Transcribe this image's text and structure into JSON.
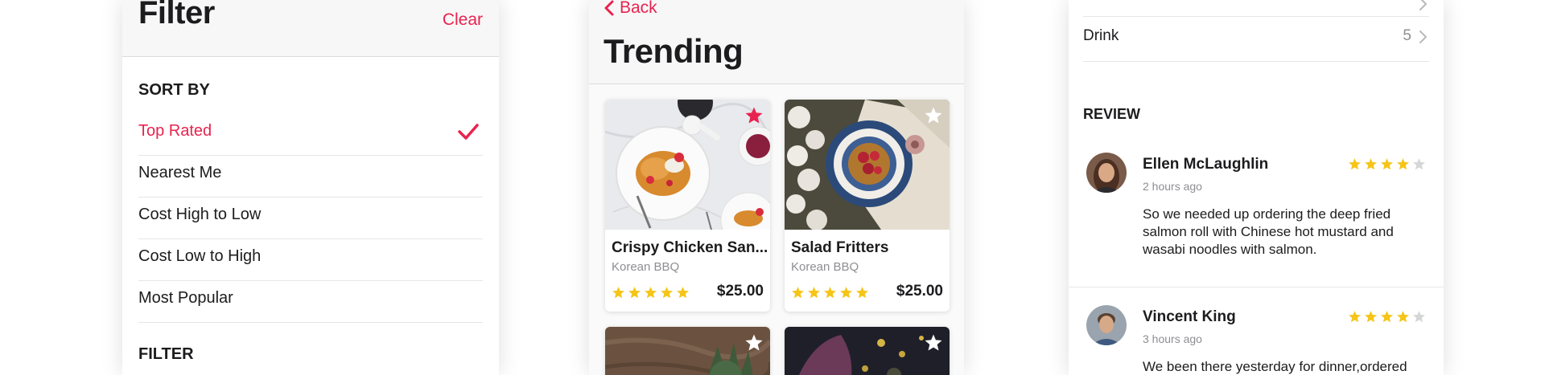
{
  "filter": {
    "title": "Filter",
    "clear_label": "Clear",
    "sort_heading": "SORT BY",
    "sort_options": [
      {
        "label": "Top Rated",
        "selected": true
      },
      {
        "label": "Nearest Me",
        "selected": false
      },
      {
        "label": "Cost High to Low",
        "selected": false
      },
      {
        "label": "Cost Low to High",
        "selected": false
      },
      {
        "label": "Most Popular",
        "selected": false
      }
    ],
    "filter_heading": "FILTER"
  },
  "trending": {
    "back_label": "Back",
    "title": "Trending",
    "items": [
      {
        "name": "Crispy Chicken San...",
        "category": "Korean BBQ",
        "price": "$25.00",
        "rating": 5,
        "favorite": true
      },
      {
        "name": "Salad Fritters",
        "category": "Korean BBQ",
        "price": "$25.00",
        "rating": 5,
        "favorite": false
      },
      {
        "favorite": false
      },
      {
        "favorite": false
      }
    ]
  },
  "detail": {
    "menu_rows": [
      {
        "label": "Drink",
        "count": "5"
      }
    ],
    "review_heading": "REVIEW",
    "reviews": [
      {
        "name": "Ellen McLaughlin",
        "time": "2 hours ago",
        "rating": 4,
        "text": "So we needed up ordering the deep fried salmon roll with Chinese hot mustard and wasabi noodles with salmon."
      },
      {
        "name": "Vincent King",
        "time": "3 hours ago",
        "rating": 4,
        "text": "We been there yesterday for dinner,ordered"
      }
    ]
  },
  "colors": {
    "accent": "#e8234f",
    "star": "#f5c518",
    "star_empty": "#d6d6d6"
  },
  "icons": {
    "check": "checkmark-icon",
    "back": "chevron-left-icon",
    "favorite": "star-icon",
    "row": "chevron-right-icon"
  }
}
